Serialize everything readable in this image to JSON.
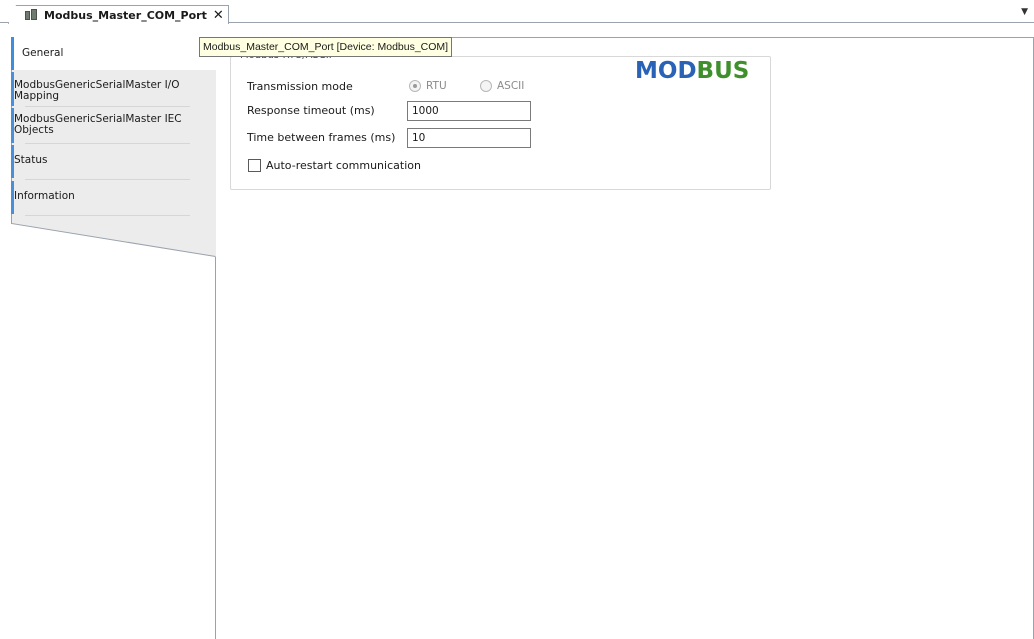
{
  "tab": {
    "title": "Modbus_Master_COM_Port",
    "close_glyph": "✕",
    "icon": "device-icon",
    "dropdown_glyph": "▼"
  },
  "tooltip": {
    "text": "Modbus_Master_COM_Port [Device: Modbus_COM]"
  },
  "nav": {
    "items": [
      {
        "label": "General",
        "active": true
      },
      {
        "label": "ModbusGenericSerialMaster I/O Mapping"
      },
      {
        "label": "ModbusGenericSerialMaster IEC Objects"
      },
      {
        "label": "Status"
      },
      {
        "label": "Information"
      }
    ]
  },
  "group": {
    "legend": "Modbus-RTU/ASCII"
  },
  "form": {
    "transmission_mode_label": "Transmission mode",
    "mode_options": [
      {
        "label": "RTU",
        "selected": true,
        "enabled": false
      },
      {
        "label": "ASCII",
        "selected": false,
        "enabled": false
      }
    ],
    "response_timeout_label": "Response timeout (ms)",
    "response_timeout_value": "1000",
    "time_between_frames_label": "Time between frames (ms)",
    "time_between_frames_value": "10",
    "auto_restart_label": "Auto-restart communication",
    "auto_restart_checked": false
  },
  "logo": {
    "text": "MODBUS",
    "colors": {
      "blue": "#2a62b5",
      "green": "#3f8f2d"
    }
  },
  "colors": {
    "accent": "#3e8ede",
    "tooltip_bg": "#ffffe1",
    "nav_bg": "#ececec"
  }
}
